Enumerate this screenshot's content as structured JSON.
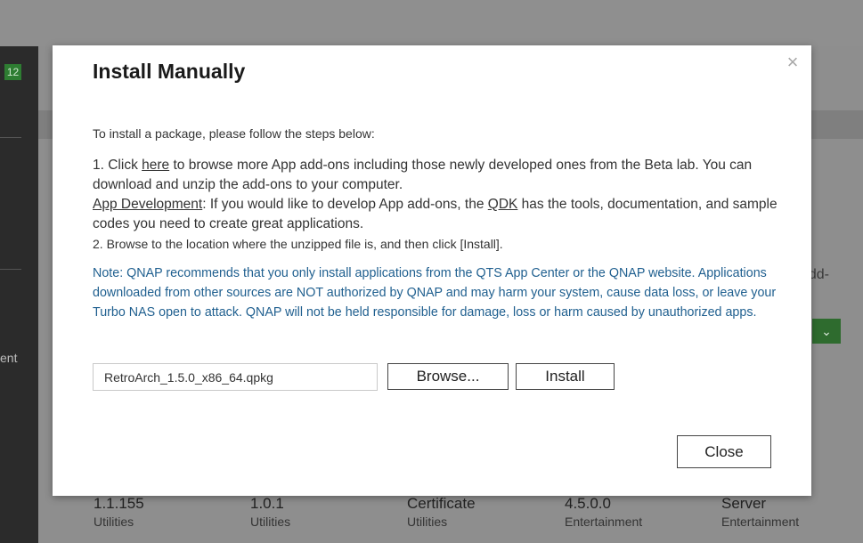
{
  "background": {
    "badge": "12",
    "sidebar_partial_text": "ent",
    "right_partial_text": "dd-",
    "apps": [
      {
        "version": "1.1.155",
        "category": "Utilities"
      },
      {
        "version": "1.0.1",
        "category": "Utilities"
      },
      {
        "version": "Certificate",
        "category": "Utilities"
      },
      {
        "version": "4.5.0.0",
        "category": "Entertainment"
      },
      {
        "version": "Server",
        "category": "Entertainment"
      }
    ]
  },
  "dialog": {
    "title": "Install Manually",
    "intro": "To install a package, please follow the steps below:",
    "step1_prefix": "1. Click ",
    "step1_link": "here",
    "step1_suffix": " to browse more App add-ons including those newly developed ones from the Beta lab. You can download and unzip the add-ons to your computer.",
    "appdev_link": "App Development",
    "appdev_prefix": ": If you would like to develop App add-ons, the ",
    "qdk_link": "QDK",
    "appdev_suffix": " has the tools, documentation, and sample codes you need to create great applications.",
    "step2": "2. Browse to the location where the unzipped file is, and then click [Install].",
    "note_label": "Note",
    "note_text": ": QNAP recommends that you only install applications from the QTS App Center or the QNAP website. Applications downloaded from other sources are NOT authorized by QNAP and may harm your system, cause data loss, or leave your Turbo NAS open to attack. QNAP will not be held responsible for damage, loss or harm caused by unauthorized apps.",
    "file_value": "RetroArch_1.5.0_x86_64.qpkg",
    "browse_label": "Browse...",
    "install_label": "Install",
    "close_label": "Close",
    "close_icon": "×"
  },
  "colors": {
    "note": "#1f5f8f",
    "badge": "#2e7d32",
    "overlay": "#8f8f8f"
  }
}
